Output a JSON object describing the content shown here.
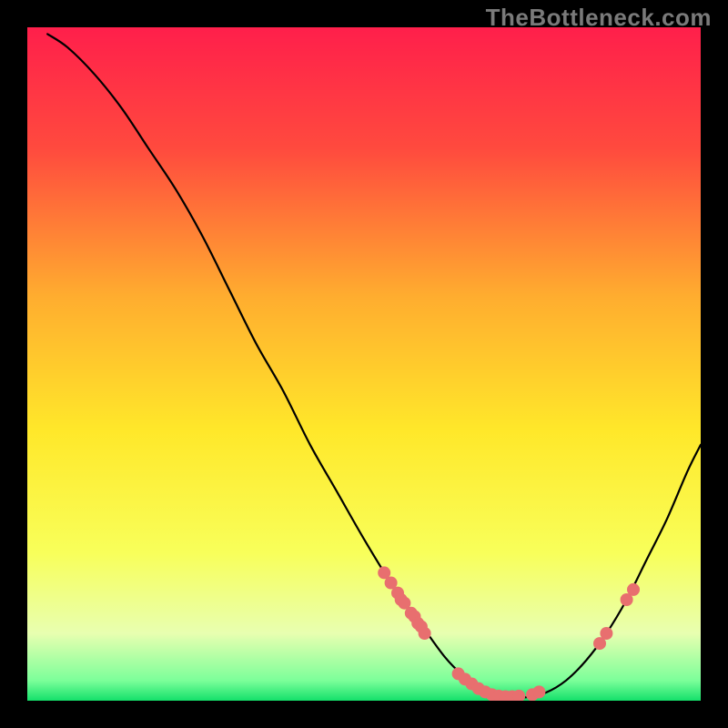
{
  "watermark": "TheBottleneck.com",
  "chart_data": {
    "type": "line",
    "title": "",
    "xlabel": "",
    "ylabel": "",
    "xlim": [
      0,
      100
    ],
    "ylim": [
      0,
      100
    ],
    "gradient_stops": [
      {
        "offset": 0,
        "color": "#ff1f4b"
      },
      {
        "offset": 18,
        "color": "#ff4a3e"
      },
      {
        "offset": 40,
        "color": "#ffad2f"
      },
      {
        "offset": 60,
        "color": "#ffe82a"
      },
      {
        "offset": 78,
        "color": "#f8ff5a"
      },
      {
        "offset": 90,
        "color": "#e8ffb0"
      },
      {
        "offset": 97,
        "color": "#7cff9a"
      },
      {
        "offset": 100,
        "color": "#14e06a"
      }
    ],
    "curve": [
      {
        "x": 3,
        "y": 99
      },
      {
        "x": 6,
        "y": 97
      },
      {
        "x": 10,
        "y": 93
      },
      {
        "x": 14,
        "y": 88
      },
      {
        "x": 18,
        "y": 82
      },
      {
        "x": 22,
        "y": 76
      },
      {
        "x": 26,
        "y": 69
      },
      {
        "x": 30,
        "y": 61
      },
      {
        "x": 34,
        "y": 53
      },
      {
        "x": 38,
        "y": 46
      },
      {
        "x": 42,
        "y": 38
      },
      {
        "x": 46,
        "y": 31
      },
      {
        "x": 50,
        "y": 24
      },
      {
        "x": 54,
        "y": 17.5
      },
      {
        "x": 58,
        "y": 12
      },
      {
        "x": 62,
        "y": 6.5
      },
      {
        "x": 65,
        "y": 3.5
      },
      {
        "x": 68,
        "y": 1.5
      },
      {
        "x": 71,
        "y": 0.6
      },
      {
        "x": 74,
        "y": 0.5
      },
      {
        "x": 77,
        "y": 1.2
      },
      {
        "x": 80,
        "y": 3
      },
      {
        "x": 83,
        "y": 6
      },
      {
        "x": 86,
        "y": 10
      },
      {
        "x": 89,
        "y": 15
      },
      {
        "x": 92,
        "y": 21
      },
      {
        "x": 95,
        "y": 27
      },
      {
        "x": 98,
        "y": 34
      },
      {
        "x": 100,
        "y": 38
      }
    ],
    "markers": [
      {
        "x": 53,
        "y": 19
      },
      {
        "x": 54,
        "y": 17.5
      },
      {
        "x": 55,
        "y": 16
      },
      {
        "x": 55.5,
        "y": 15
      },
      {
        "x": 56,
        "y": 14.5
      },
      {
        "x": 57,
        "y": 13
      },
      {
        "x": 57.5,
        "y": 12.5
      },
      {
        "x": 58,
        "y": 11.5
      },
      {
        "x": 58.5,
        "y": 11
      },
      {
        "x": 59,
        "y": 10
      },
      {
        "x": 64,
        "y": 4
      },
      {
        "x": 65,
        "y": 3.2
      },
      {
        "x": 66,
        "y": 2.5
      },
      {
        "x": 67,
        "y": 1.8
      },
      {
        "x": 68,
        "y": 1.3
      },
      {
        "x": 69,
        "y": 0.9
      },
      {
        "x": 70,
        "y": 0.7
      },
      {
        "x": 71,
        "y": 0.6
      },
      {
        "x": 72,
        "y": 0.6
      },
      {
        "x": 73,
        "y": 0.7
      },
      {
        "x": 75,
        "y": 0.9
      },
      {
        "x": 76,
        "y": 1.3
      },
      {
        "x": 85,
        "y": 8.5
      },
      {
        "x": 86,
        "y": 10
      },
      {
        "x": 89,
        "y": 15
      },
      {
        "x": 90,
        "y": 16.5
      }
    ],
    "marker_color": "#e86f6f",
    "marker_radius": 7,
    "curve_color": "#000000",
    "curve_width": 2.2
  }
}
